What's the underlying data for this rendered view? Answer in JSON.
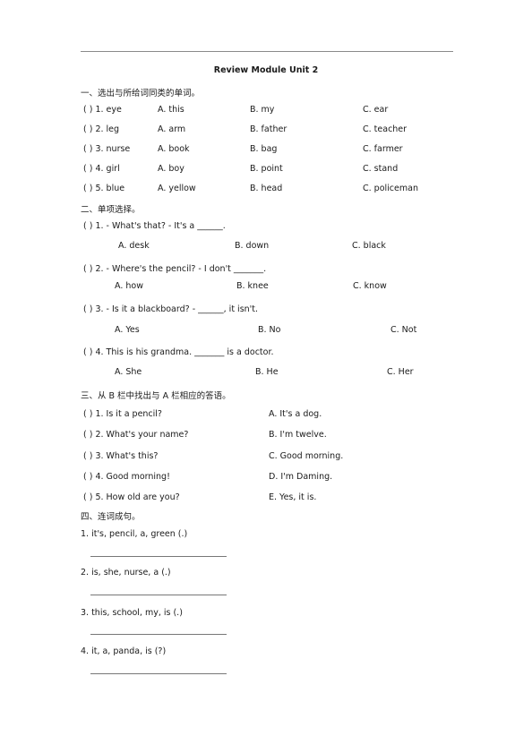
{
  "title": "Review Module Unit 2",
  "section1": {
    "heading": "一、选出与所给词同类的单词。",
    "items": [
      {
        "q": "(   ) 1. eye",
        "a": "A. this",
        "b": "B. my",
        "c": "C. ear"
      },
      {
        "q": "(   ) 2. leg",
        "a": "A. arm",
        "b": "B. father",
        "c": "C. teacher"
      },
      {
        "q": "(   ) 3. nurse",
        "a": "A. book",
        "b": "B. bag",
        "c": "C. farmer"
      },
      {
        "q": "(   ) 4. girl",
        "a": "A. boy",
        "b": "B. point",
        "c": "C. stand"
      },
      {
        "q": "(   ) 5. blue",
        "a": "A. yellow",
        "b": "B. head",
        "c": "C. policeman"
      }
    ]
  },
  "section2": {
    "heading": "二、单项选择。",
    "items": [
      {
        "q": "(   ) 1. - What's that?      - It's a ______.",
        "a": "A.  desk",
        "b": "B. down",
        "c": "C. black"
      },
      {
        "q": "(   ) 2. - Where's the pencil?   - I don't _______.",
        "a": "A. how",
        "b": "B. knee",
        "c": "C. know"
      },
      {
        "q": "(   ) 3. - Is it a blackboard?    - ______, it isn't.",
        "a": "A. Yes",
        "b": "B. No",
        "c": "C. Not"
      },
      {
        "q": "(   ) 4. This is his grandma. _______ is a doctor.",
        "a": "A. She",
        "b": "B. He",
        "c": "C. Her"
      }
    ]
  },
  "section3": {
    "heading": "三、从 B 栏中找出与 A 栏相应的答语。",
    "items": [
      {
        "q": "(   ) 1. Is it a pencil?",
        "ans": "A. It's a dog."
      },
      {
        "q": "(   ) 2. What's your name?",
        "ans": "B. I'm twelve."
      },
      {
        "q": "(   ) 3. What's this?",
        "ans": "C. Good morning."
      },
      {
        "q": "(   ) 4. Good morning!",
        "ans": "D. I'm Daming."
      },
      {
        "q": "(   ) 5. How old are you?",
        "ans": "E. Yes, it is."
      }
    ]
  },
  "section4": {
    "heading": "四、连词成句。",
    "items": [
      {
        "q": "1. it's, pencil, a, green   (.)"
      },
      {
        "q": "2. is, she, nurse, a     (.)"
      },
      {
        "q": "3. this, school, my, is    (.)"
      },
      {
        "q": "4. it, a, panda, is   (?)"
      }
    ]
  }
}
